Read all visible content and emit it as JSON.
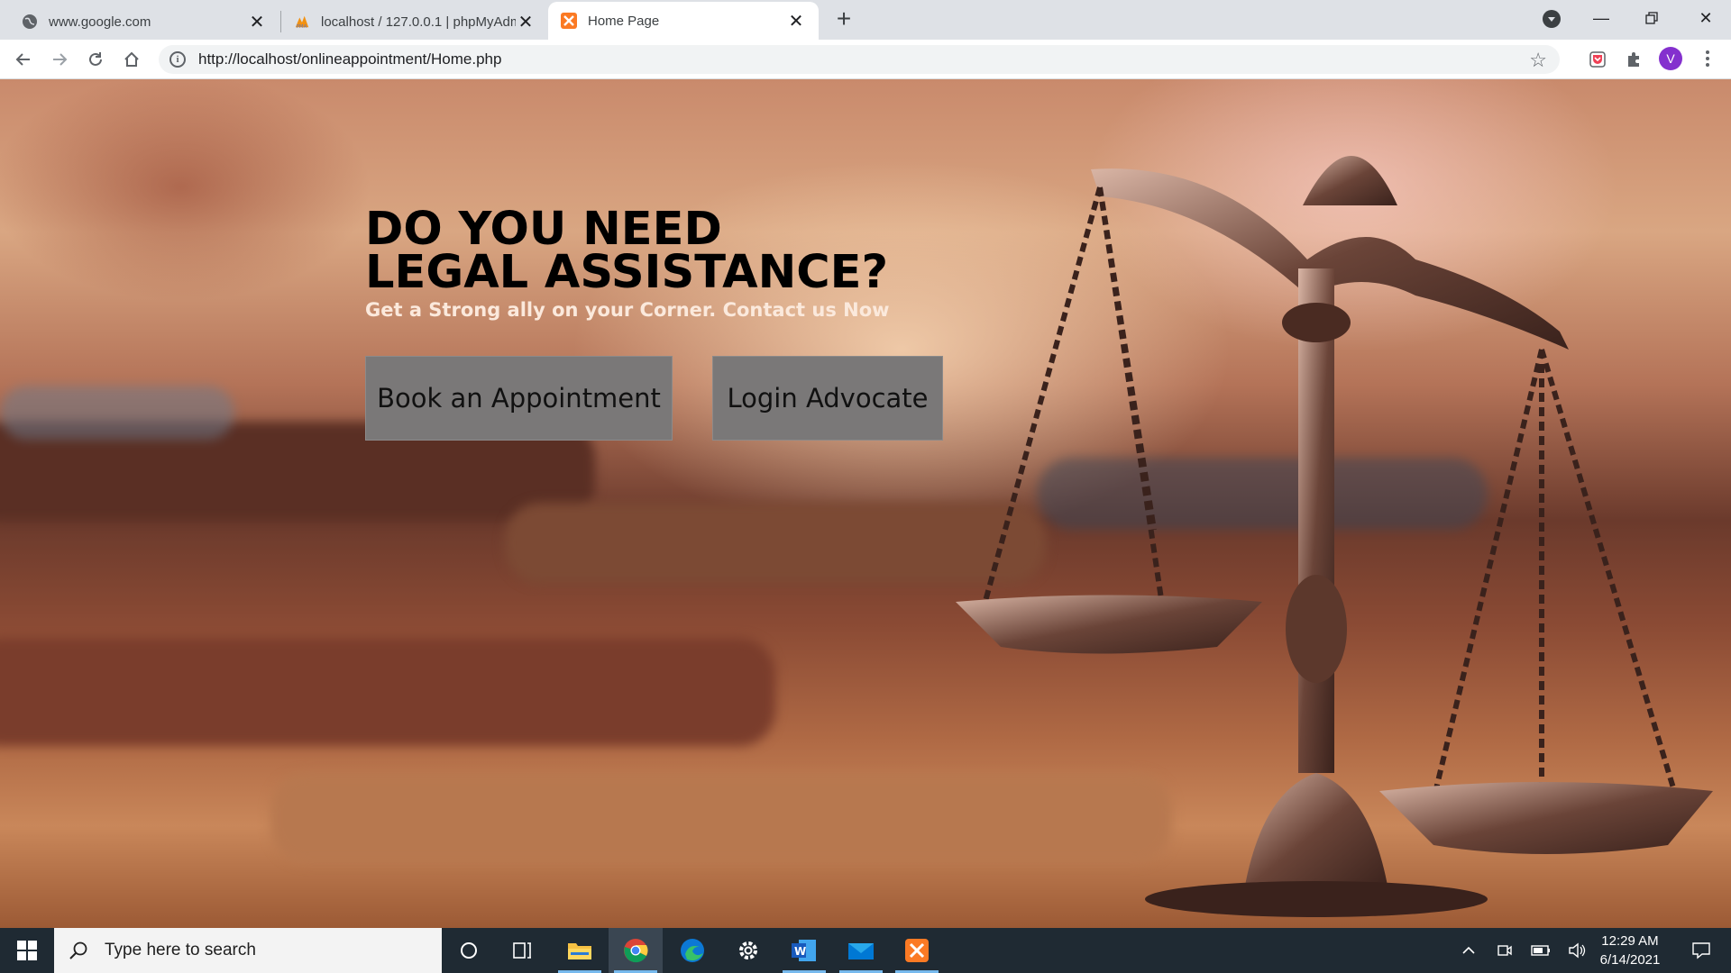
{
  "browser": {
    "tabs": [
      {
        "title": "www.google.com",
        "favicon": "globe-icon"
      },
      {
        "title": "localhost / 127.0.0.1 | phpMyAdmin",
        "favicon": "phpmyadmin-icon"
      },
      {
        "title": "Home Page",
        "favicon": "xampp-icon",
        "active": true
      }
    ],
    "new_tab_label": "+",
    "url": "http://localhost/onlineappointment/Home.php",
    "profile_initial": "V"
  },
  "page": {
    "headline_line1": "DO YOU NEED",
    "headline_line2": "LEGAL ASSISTANCE?",
    "tagline": "Get a Strong ally on your Corner. Contact us Now",
    "buttons": {
      "book": "Book an Appointment",
      "login": "Login Advocate"
    }
  },
  "taskbar": {
    "search_placeholder": "Type here to search",
    "pinned_apps": [
      "cortana-icon",
      "task-view-icon",
      "file-explorer-icon",
      "chrome-icon",
      "edge-icon",
      "settings-icon",
      "word-icon",
      "mail-icon",
      "xampp-icon"
    ],
    "time": "12:29 AM",
    "date": "6/14/2021"
  },
  "colors": {
    "button_bg": "#7a7878",
    "headline": "#000000",
    "tagline": "#fbe9dc",
    "taskbar": "#1f2a33",
    "profile": "#8430ce"
  }
}
